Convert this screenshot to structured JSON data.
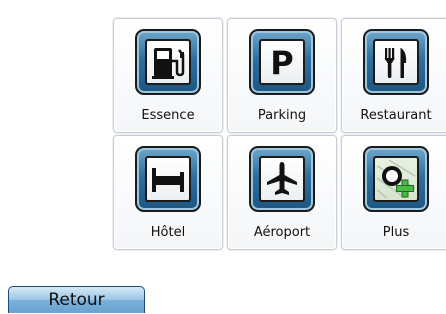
{
  "tiles": [
    {
      "label": "Essence",
      "icon": "fuel-pump-icon"
    },
    {
      "label": "Parking",
      "icon": "parking-icon"
    },
    {
      "label": "Restaurant",
      "icon": "fork-knife-icon"
    },
    {
      "label": "Hôtel",
      "icon": "bed-icon"
    },
    {
      "label": "Aéroport",
      "icon": "airplane-icon"
    },
    {
      "label": "Plus",
      "icon": "more-target-plus-icon"
    }
  ],
  "back_button": {
    "label": "Retour"
  },
  "colors": {
    "icon_frame": "#2f6f9e",
    "button": "#8bbde2",
    "plus_badge": "#4bb84a"
  }
}
